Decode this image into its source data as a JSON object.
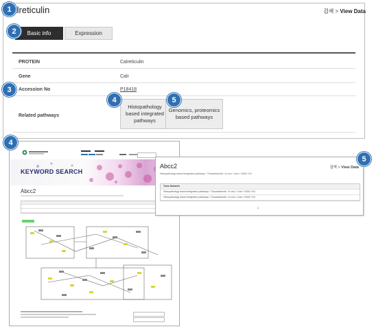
{
  "header": {
    "title": "Calreticulin",
    "breadcrumb_home": "검색",
    "breadcrumb_sep": ">",
    "breadcrumb_current": "View Data"
  },
  "tabs": [
    {
      "label": "Basic info"
    },
    {
      "label": "Expression"
    }
  ],
  "fields": {
    "protein": {
      "label": "PROTEIN",
      "value": "Calreticulin"
    },
    "gene": {
      "label": "Gene",
      "value": "Calr"
    },
    "accession": {
      "label": "Accession No",
      "value": "P18418"
    },
    "pathways": {
      "label": "Related pathways",
      "buttons": [
        {
          "label": "Histopathology based integrated pathways"
        },
        {
          "label": "Genomics, proteomics based pathways"
        }
      ]
    }
  },
  "badges": [
    "1",
    "2",
    "3",
    "4",
    "5",
    "4",
    "5"
  ],
  "screenshot_a": {
    "banner_title": "KEYWORD SEARCH",
    "page_title": "Abcc2"
  },
  "screenshot_b": {
    "page_title": "Abcc2",
    "breadcrumb_home": "검색",
    "breadcrumb_current": "View Data",
    "subtitle": "Histopathology based integrated pathways / Thioacetamide / In vivo / Liver / NGM / R4",
    "table_header": "Toxic Network",
    "rows": [
      "Histopathology based integrated pathways / Thioacetamide / In vivo / Liver / NGM / R4",
      "Histopathology based integrated pathways / Thioacetamide / In vivo / Liver / NGM / R4"
    ],
    "pager": "1"
  }
}
